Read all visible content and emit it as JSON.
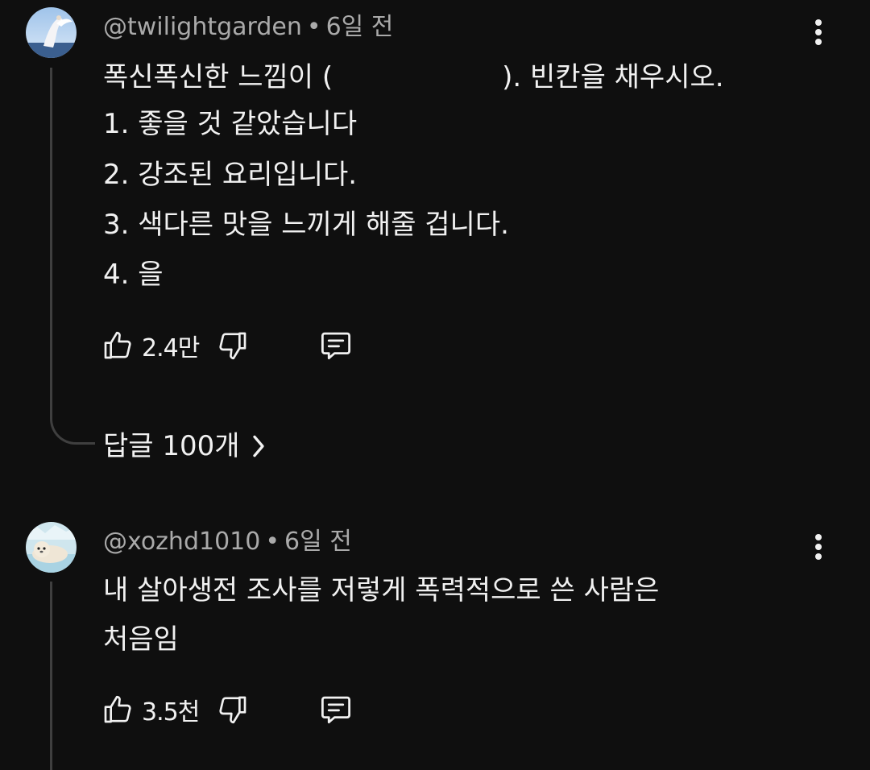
{
  "comments": [
    {
      "handle": "@twilightgarden",
      "time": "6일 전",
      "body_line_1a": "폭신폭신한 느낌이 (",
      "body_line_1b": "). 빈칸을 채우시오.",
      "lines": [
        "1. 좋을 것 같았습니다",
        "2. 강조된 요리입니다.",
        "3. 색다른 맛을 느끼게 해줄 겁니다.",
        "4. 을"
      ],
      "likes": "2.4만",
      "replies_label": "답글 100개"
    },
    {
      "handle": "@xozhd1010",
      "time": "6일 전",
      "lines": [
        "내 살아생전 조사를 저렇게 폭력적으로 쓴 사람은",
        "처음임"
      ],
      "likes": "3.5천"
    }
  ],
  "separator": "•",
  "icons": {
    "like": "thumbs-up-icon",
    "dislike": "thumbs-down-icon",
    "reply": "comment-icon",
    "menu": "more-vertical-icon",
    "chevron": "chevron-right-icon"
  },
  "colors": {
    "background": "#0f0f0f",
    "text": "#f1f1f1",
    "meta": "#aaaaaa",
    "thread": "#3f3f3f"
  }
}
